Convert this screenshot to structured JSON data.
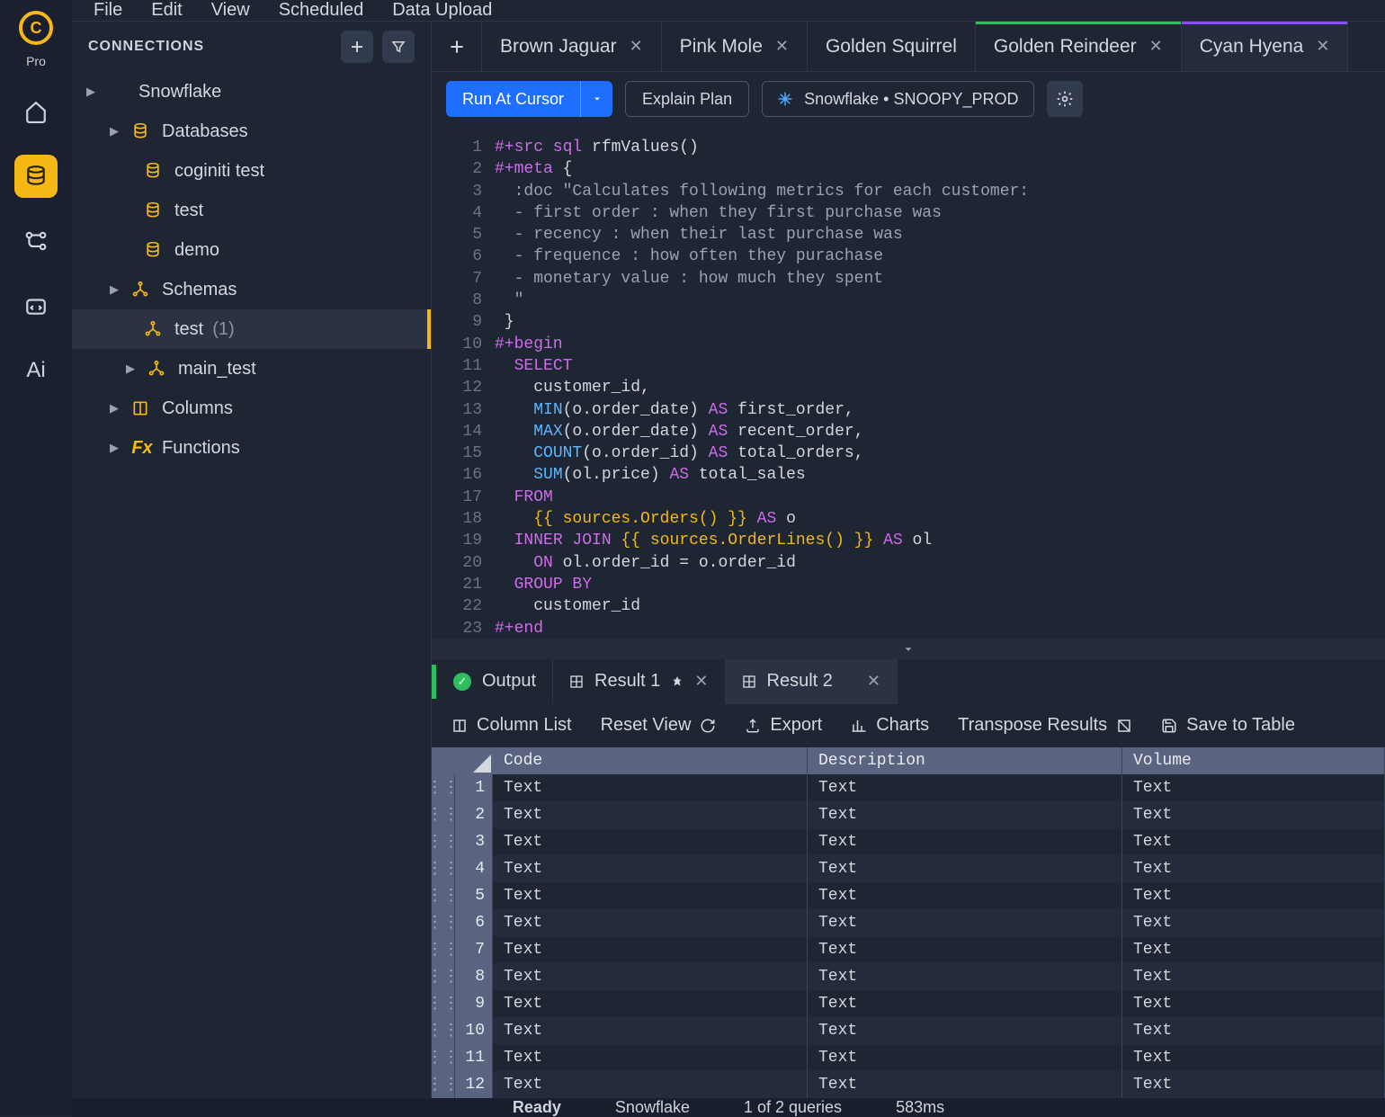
{
  "leftrail": {
    "pro_label": "Pro",
    "ai_label": "Ai"
  },
  "menu": {
    "file": "File",
    "edit": "Edit",
    "view": "View",
    "scheduled": "Scheduled",
    "dataupload": "Data Upload"
  },
  "sidebar": {
    "header": "CONNECTIONS",
    "tree": {
      "snowflake": "Snowflake",
      "databases": "Databases",
      "db1": "coginiti test",
      "db2": "test",
      "db3": "demo",
      "schemas": "Schemas",
      "schema_test": "test",
      "schema_test_count": "(1)",
      "main_test": "main_test",
      "columns": "Columns",
      "functions": "Functions"
    }
  },
  "tabs": [
    {
      "label": "Brown Jaguar",
      "stripe": ""
    },
    {
      "label": "Pink Mole",
      "stripe": ""
    },
    {
      "label": "Golden Squirrel",
      "stripe": ""
    },
    {
      "label": "Golden Reindeer",
      "stripe": "#2dbf5f"
    },
    {
      "label": "Cyan Hyena",
      "stripe": "#8a4dff"
    }
  ],
  "toolbar": {
    "run": "Run At Cursor",
    "explain": "Explain Plan",
    "connection": "Snowflake • SNOOPY_PROD"
  },
  "code": {
    "lines": [
      [
        {
          "c": "tk-dir",
          "t": "#+src sql"
        },
        {
          "c": "",
          "t": " rfmValues()"
        }
      ],
      [
        {
          "c": "tk-dir",
          "t": "#+meta"
        },
        {
          "c": "",
          "t": " {"
        }
      ],
      [
        {
          "c": "tk-mute",
          "t": "  :doc \"Calculates following metrics for each customer:"
        }
      ],
      [
        {
          "c": "tk-mute",
          "t": "  - first order : when they first purchase was"
        }
      ],
      [
        {
          "c": "tk-mute",
          "t": "  - recency : when their last purchase was"
        }
      ],
      [
        {
          "c": "tk-mute",
          "t": "  - frequence : how often they purachase"
        }
      ],
      [
        {
          "c": "tk-mute",
          "t": "  - monetary value : how much they spent"
        }
      ],
      [
        {
          "c": "tk-mute",
          "t": "  \""
        }
      ],
      [
        {
          "c": "",
          "t": " }"
        }
      ],
      [
        {
          "c": "tk-dir",
          "t": "#+begin"
        }
      ],
      [
        {
          "c": "",
          "t": "  "
        },
        {
          "c": "tk-kw",
          "t": "SELECT"
        }
      ],
      [
        {
          "c": "",
          "t": "    customer_id,"
        }
      ],
      [
        {
          "c": "",
          "t": "    "
        },
        {
          "c": "tk-fn",
          "t": "MIN"
        },
        {
          "c": "",
          "t": "(o.order_date) "
        },
        {
          "c": "tk-kw",
          "t": "AS"
        },
        {
          "c": "",
          "t": " first_order,"
        }
      ],
      [
        {
          "c": "",
          "t": "    "
        },
        {
          "c": "tk-fn",
          "t": "MAX"
        },
        {
          "c": "",
          "t": "(o.order_date) "
        },
        {
          "c": "tk-kw",
          "t": "AS"
        },
        {
          "c": "",
          "t": " recent_order,"
        }
      ],
      [
        {
          "c": "",
          "t": "    "
        },
        {
          "c": "tk-fn",
          "t": "COUNT"
        },
        {
          "c": "",
          "t": "(o.order_id) "
        },
        {
          "c": "tk-kw",
          "t": "AS"
        },
        {
          "c": "",
          "t": " total_orders,"
        }
      ],
      [
        {
          "c": "",
          "t": "    "
        },
        {
          "c": "tk-fn",
          "t": "SUM"
        },
        {
          "c": "",
          "t": "(ol.price) "
        },
        {
          "c": "tk-kw",
          "t": "AS"
        },
        {
          "c": "",
          "t": " total_sales"
        }
      ],
      [
        {
          "c": "",
          "t": "  "
        },
        {
          "c": "tk-kw",
          "t": "FROM"
        }
      ],
      [
        {
          "c": "",
          "t": "    "
        },
        {
          "c": "tk-tpl",
          "t": "{{ sources.Orders() }}"
        },
        {
          "c": "",
          "t": " "
        },
        {
          "c": "tk-kw",
          "t": "AS"
        },
        {
          "c": "",
          "t": " o"
        }
      ],
      [
        {
          "c": "",
          "t": "  "
        },
        {
          "c": "tk-kw",
          "t": "INNER JOIN"
        },
        {
          "c": "",
          "t": " "
        },
        {
          "c": "tk-tpl",
          "t": "{{ sources.OrderLines() }}"
        },
        {
          "c": "",
          "t": " "
        },
        {
          "c": "tk-kw",
          "t": "AS"
        },
        {
          "c": "",
          "t": " ol"
        }
      ],
      [
        {
          "c": "",
          "t": "    "
        },
        {
          "c": "tk-kw",
          "t": "ON"
        },
        {
          "c": "",
          "t": " ol.order_id = o.order_id"
        }
      ],
      [
        {
          "c": "",
          "t": "  "
        },
        {
          "c": "tk-kw",
          "t": "GROUP BY"
        }
      ],
      [
        {
          "c": "",
          "t": "    customer_id"
        }
      ],
      [
        {
          "c": "tk-dir",
          "t": "#+end"
        }
      ]
    ]
  },
  "results": {
    "tabs": {
      "output": "Output",
      "r1": "Result 1",
      "r2": "Result 2"
    },
    "toolbar": {
      "columnlist": "Column List",
      "resetview": "Reset View",
      "export": "Export",
      "charts": "Charts",
      "transpose": "Transpose Results",
      "savetable": "Save to Table"
    },
    "columns": [
      "Code",
      "Description",
      "Volume"
    ],
    "rows": [
      [
        "Text",
        "Text",
        "Text"
      ],
      [
        "Text",
        "Text",
        "Text"
      ],
      [
        "Text",
        "Text",
        "Text"
      ],
      [
        "Text",
        "Text",
        "Text"
      ],
      [
        "Text",
        "Text",
        "Text"
      ],
      [
        "Text",
        "Text",
        "Text"
      ],
      [
        "Text",
        "Text",
        "Text"
      ],
      [
        "Text",
        "Text",
        "Text"
      ],
      [
        "Text",
        "Text",
        "Text"
      ],
      [
        "Text",
        "Text",
        "Text"
      ],
      [
        "Text",
        "Text",
        "Text"
      ],
      [
        "Text",
        "Text",
        "Text"
      ]
    ]
  },
  "status": {
    "ready": "Ready",
    "conn": "Snowflake",
    "queries": "1 of 2 queries",
    "time": "583ms"
  }
}
